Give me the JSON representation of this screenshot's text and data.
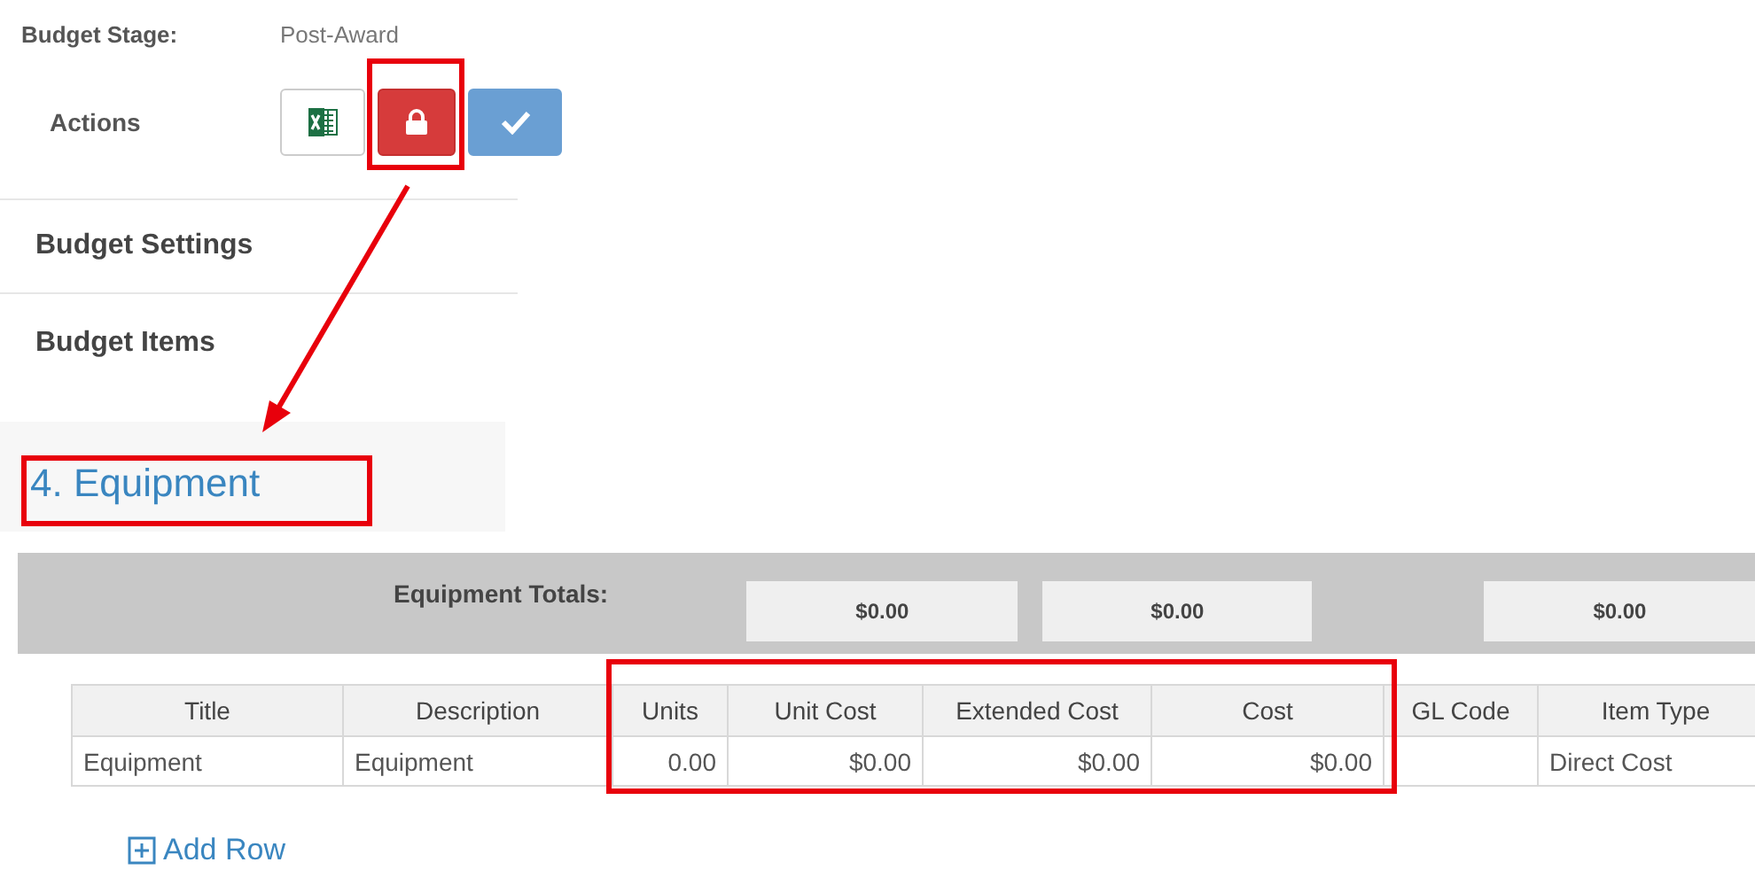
{
  "budget_stage": {
    "label": "Budget Stage:",
    "value": "Post-Award"
  },
  "actions": {
    "label": "Actions",
    "buttons": [
      {
        "kind": "excel"
      },
      {
        "kind": "lock"
      },
      {
        "kind": "check"
      }
    ]
  },
  "nav": [
    {
      "label": "Budget Settings"
    },
    {
      "label": "Budget Items"
    }
  ],
  "section": {
    "title": "4. Equipment"
  },
  "totals": {
    "label": "Equipment Totals:",
    "values": [
      "$0.00",
      "$0.00",
      "$0.00"
    ]
  },
  "table": {
    "columns": [
      "Title",
      "Description",
      "Units",
      "Unit Cost",
      "Extended Cost",
      "Cost",
      "GL Code",
      "Item Type"
    ],
    "rows": [
      [
        "Equipment",
        "Equipment",
        "0.00",
        "$0.00",
        "$0.00",
        "$0.00",
        "",
        "Direct Cost"
      ]
    ]
  },
  "add_row": {
    "label": "Add Row"
  }
}
